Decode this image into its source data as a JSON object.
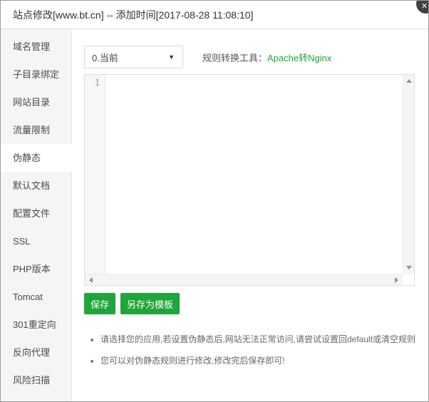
{
  "dialog": {
    "title": "站点修改[www.bt.cn] -- 添加时间[2017-08-28 11:08:10]",
    "icons": {
      "close": "✕",
      "select_arrow": "▼"
    }
  },
  "sidebar": {
    "items": [
      {
        "label": "域名管理",
        "selected": false
      },
      {
        "label": "子目录绑定",
        "selected": false
      },
      {
        "label": "网站目录",
        "selected": false
      },
      {
        "label": "流量限制",
        "selected": false
      },
      {
        "label": "伪静态",
        "selected": true
      },
      {
        "label": "默认文档",
        "selected": false
      },
      {
        "label": "配置文件",
        "selected": false
      },
      {
        "label": "SSL",
        "selected": false
      },
      {
        "label": "PHP版本",
        "selected": false
      },
      {
        "label": "Tomcat",
        "selected": false
      },
      {
        "label": "301重定向",
        "selected": false
      },
      {
        "label": "反向代理",
        "selected": false
      },
      {
        "label": "风险扫描",
        "selected": false
      }
    ]
  },
  "main": {
    "rule_select": {
      "value": "0.当前"
    },
    "converter": {
      "label": "规则转换工具：",
      "link_text": "Apache转Nginx"
    },
    "editor": {
      "first_line_number": "1",
      "content": ""
    },
    "buttons": {
      "save": "保存",
      "save_as_template": "另存为模板"
    },
    "tips": [
      "请选择您的应用,若设置伪静态后,网站无法正常访问,请尝试设置回default或清空规则",
      "您可以对伪静态规则进行修改,修改完后保存即可!"
    ]
  },
  "colors": {
    "accent_green": "#20a53a",
    "close_button_bg": "#404040"
  }
}
